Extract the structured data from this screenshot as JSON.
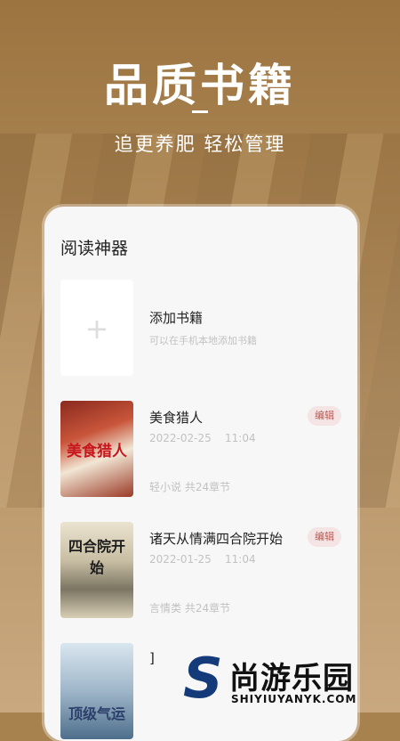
{
  "headline": "品质书籍",
  "subline": "追更养肥  轻松管理",
  "card": {
    "title": "阅读神器",
    "add": {
      "icon": "plus-icon",
      "title": "添加书籍",
      "subtitle": "可以在手机本地添加书籍"
    },
    "books": [
      {
        "cover_text": "美食猎人",
        "title": "美食猎人",
        "date": "2022-02-25",
        "time": "11:04",
        "meta": "轻小说   共24章节",
        "edit_label": "编辑"
      },
      {
        "cover_text": "四合院开始",
        "title": "诸天从情满四合院开始",
        "date": "2022-01-25",
        "time": "11:04",
        "meta": "言情类   共24章节",
        "edit_label": "编辑"
      },
      {
        "cover_text": "顶级气运",
        "title": "]"
      }
    ]
  },
  "watermark": {
    "logo_letter": "S",
    "text": "尚游乐园",
    "url": "SHIYIUYANYK.COM"
  },
  "colors": {
    "background": "#a8824e",
    "card": "#f7f7f7",
    "edit_text": "#b85a55",
    "edit_bg": "#f4e4e3"
  }
}
